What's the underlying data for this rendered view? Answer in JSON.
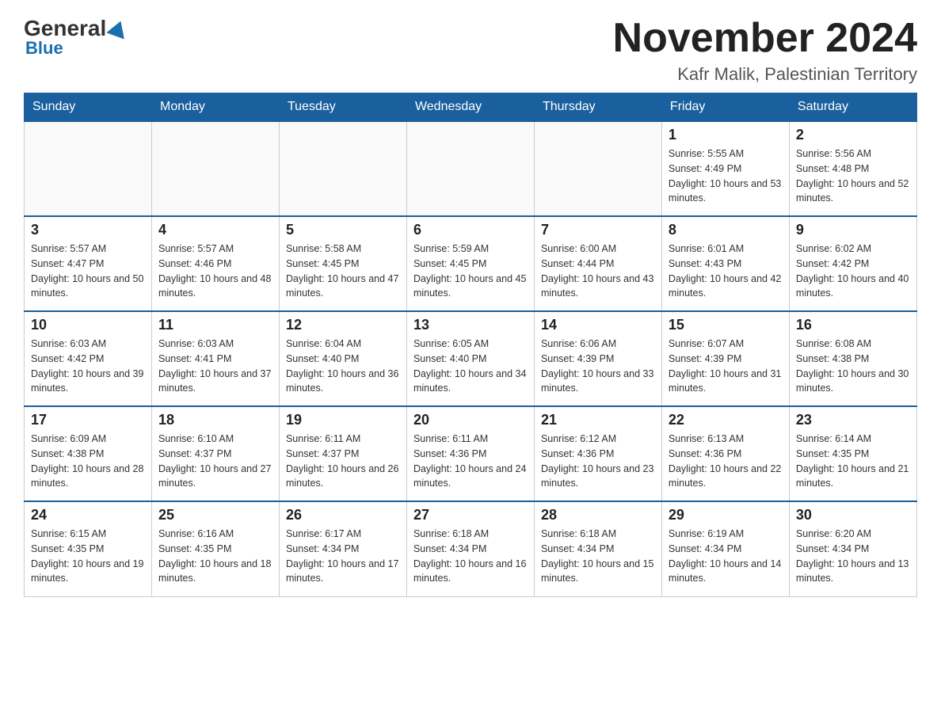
{
  "logo": {
    "general": "General",
    "blue": "Blue"
  },
  "header": {
    "month": "November 2024",
    "location": "Kafr Malik, Palestinian Territory"
  },
  "weekdays": [
    "Sunday",
    "Monday",
    "Tuesday",
    "Wednesday",
    "Thursday",
    "Friday",
    "Saturday"
  ],
  "weeks": [
    [
      {
        "day": "",
        "info": ""
      },
      {
        "day": "",
        "info": ""
      },
      {
        "day": "",
        "info": ""
      },
      {
        "day": "",
        "info": ""
      },
      {
        "day": "",
        "info": ""
      },
      {
        "day": "1",
        "info": "Sunrise: 5:55 AM\nSunset: 4:49 PM\nDaylight: 10 hours and 53 minutes."
      },
      {
        "day": "2",
        "info": "Sunrise: 5:56 AM\nSunset: 4:48 PM\nDaylight: 10 hours and 52 minutes."
      }
    ],
    [
      {
        "day": "3",
        "info": "Sunrise: 5:57 AM\nSunset: 4:47 PM\nDaylight: 10 hours and 50 minutes."
      },
      {
        "day": "4",
        "info": "Sunrise: 5:57 AM\nSunset: 4:46 PM\nDaylight: 10 hours and 48 minutes."
      },
      {
        "day": "5",
        "info": "Sunrise: 5:58 AM\nSunset: 4:45 PM\nDaylight: 10 hours and 47 minutes."
      },
      {
        "day": "6",
        "info": "Sunrise: 5:59 AM\nSunset: 4:45 PM\nDaylight: 10 hours and 45 minutes."
      },
      {
        "day": "7",
        "info": "Sunrise: 6:00 AM\nSunset: 4:44 PM\nDaylight: 10 hours and 43 minutes."
      },
      {
        "day": "8",
        "info": "Sunrise: 6:01 AM\nSunset: 4:43 PM\nDaylight: 10 hours and 42 minutes."
      },
      {
        "day": "9",
        "info": "Sunrise: 6:02 AM\nSunset: 4:42 PM\nDaylight: 10 hours and 40 minutes."
      }
    ],
    [
      {
        "day": "10",
        "info": "Sunrise: 6:03 AM\nSunset: 4:42 PM\nDaylight: 10 hours and 39 minutes."
      },
      {
        "day": "11",
        "info": "Sunrise: 6:03 AM\nSunset: 4:41 PM\nDaylight: 10 hours and 37 minutes."
      },
      {
        "day": "12",
        "info": "Sunrise: 6:04 AM\nSunset: 4:40 PM\nDaylight: 10 hours and 36 minutes."
      },
      {
        "day": "13",
        "info": "Sunrise: 6:05 AM\nSunset: 4:40 PM\nDaylight: 10 hours and 34 minutes."
      },
      {
        "day": "14",
        "info": "Sunrise: 6:06 AM\nSunset: 4:39 PM\nDaylight: 10 hours and 33 minutes."
      },
      {
        "day": "15",
        "info": "Sunrise: 6:07 AM\nSunset: 4:39 PM\nDaylight: 10 hours and 31 minutes."
      },
      {
        "day": "16",
        "info": "Sunrise: 6:08 AM\nSunset: 4:38 PM\nDaylight: 10 hours and 30 minutes."
      }
    ],
    [
      {
        "day": "17",
        "info": "Sunrise: 6:09 AM\nSunset: 4:38 PM\nDaylight: 10 hours and 28 minutes."
      },
      {
        "day": "18",
        "info": "Sunrise: 6:10 AM\nSunset: 4:37 PM\nDaylight: 10 hours and 27 minutes."
      },
      {
        "day": "19",
        "info": "Sunrise: 6:11 AM\nSunset: 4:37 PM\nDaylight: 10 hours and 26 minutes."
      },
      {
        "day": "20",
        "info": "Sunrise: 6:11 AM\nSunset: 4:36 PM\nDaylight: 10 hours and 24 minutes."
      },
      {
        "day": "21",
        "info": "Sunrise: 6:12 AM\nSunset: 4:36 PM\nDaylight: 10 hours and 23 minutes."
      },
      {
        "day": "22",
        "info": "Sunrise: 6:13 AM\nSunset: 4:36 PM\nDaylight: 10 hours and 22 minutes."
      },
      {
        "day": "23",
        "info": "Sunrise: 6:14 AM\nSunset: 4:35 PM\nDaylight: 10 hours and 21 minutes."
      }
    ],
    [
      {
        "day": "24",
        "info": "Sunrise: 6:15 AM\nSunset: 4:35 PM\nDaylight: 10 hours and 19 minutes."
      },
      {
        "day": "25",
        "info": "Sunrise: 6:16 AM\nSunset: 4:35 PM\nDaylight: 10 hours and 18 minutes."
      },
      {
        "day": "26",
        "info": "Sunrise: 6:17 AM\nSunset: 4:34 PM\nDaylight: 10 hours and 17 minutes."
      },
      {
        "day": "27",
        "info": "Sunrise: 6:18 AM\nSunset: 4:34 PM\nDaylight: 10 hours and 16 minutes."
      },
      {
        "day": "28",
        "info": "Sunrise: 6:18 AM\nSunset: 4:34 PM\nDaylight: 10 hours and 15 minutes."
      },
      {
        "day": "29",
        "info": "Sunrise: 6:19 AM\nSunset: 4:34 PM\nDaylight: 10 hours and 14 minutes."
      },
      {
        "day": "30",
        "info": "Sunrise: 6:20 AM\nSunset: 4:34 PM\nDaylight: 10 hours and 13 minutes."
      }
    ]
  ]
}
